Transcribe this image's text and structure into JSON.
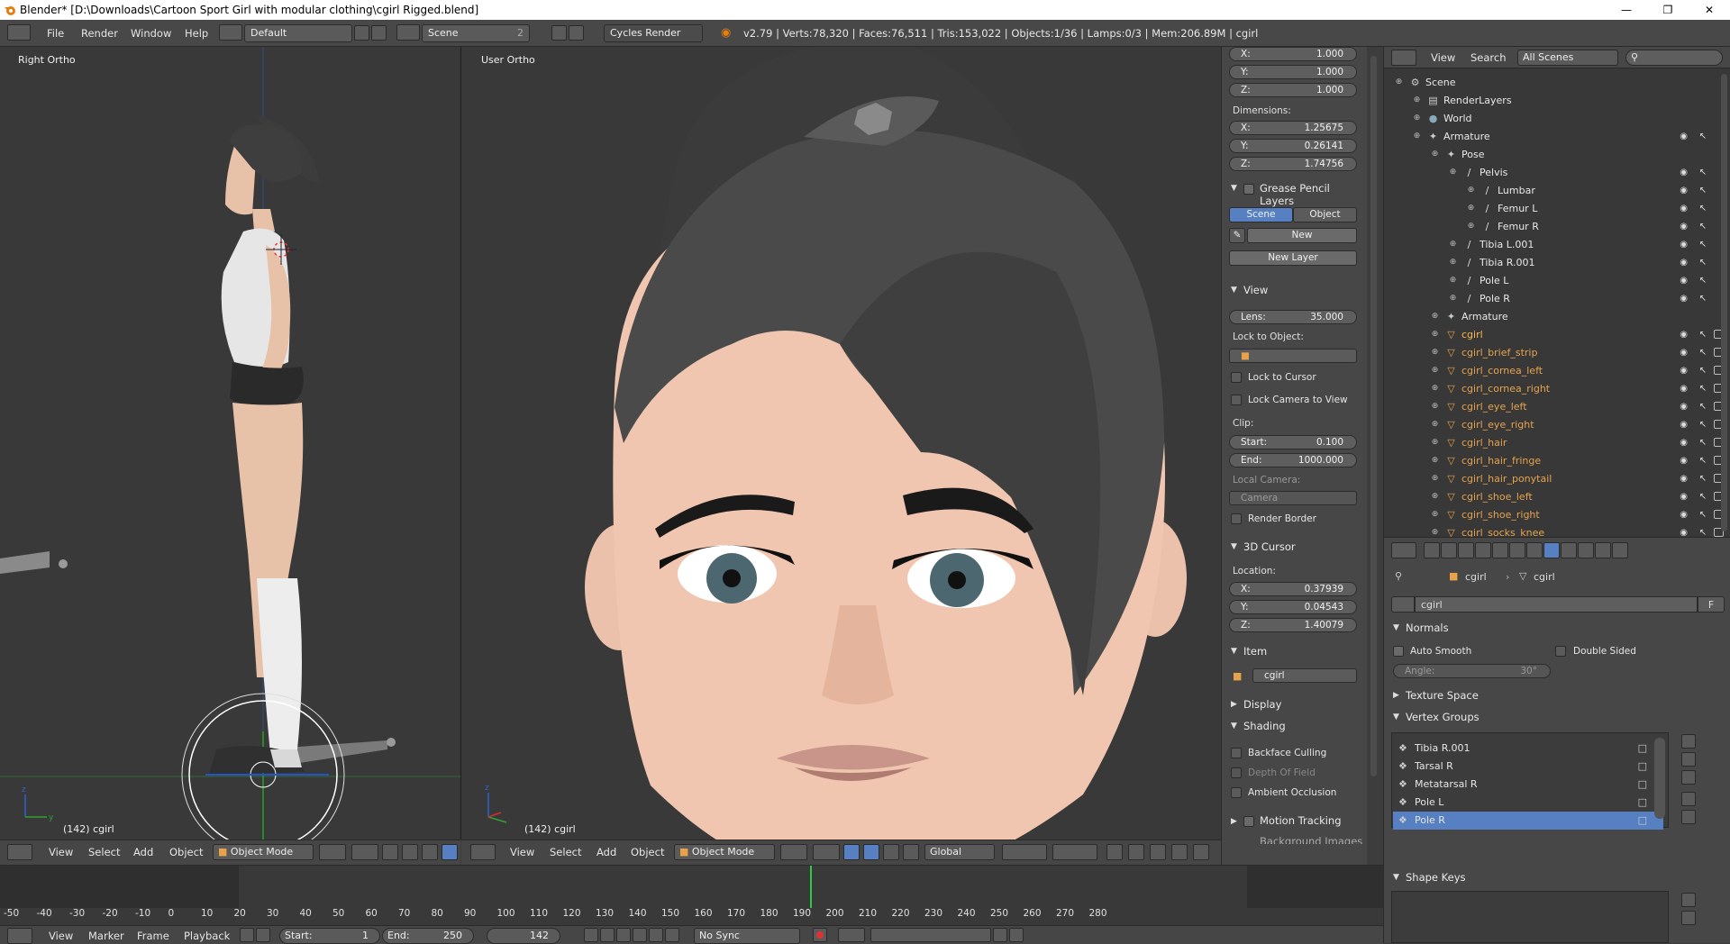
{
  "window": {
    "title": "Blender* [D:\\Downloads\\Cartoon Sport Girl with modular clothing\\cgirl Rigged.blend]"
  },
  "infobar": {
    "menus": [
      "File",
      "Render",
      "Window",
      "Help"
    ],
    "layout": "Default",
    "scene": "Scene",
    "scene_count": "2",
    "render_engine": "Cycles Render",
    "stats": "v2.79 | Verts:78,320 | Faces:76,511 | Tris:153,022 | Objects:1/36 | Lamps:0/3 | Mem:206.89M | cgirl"
  },
  "viewport_left": {
    "label": "Right Ortho",
    "frame_info": "(142) cgirl",
    "menus": [
      "View",
      "Select",
      "Add",
      "Object"
    ],
    "mode": "Object Mode"
  },
  "viewport_right": {
    "label": "User Ortho",
    "frame_info": "(142) cgirl",
    "menus": [
      "View",
      "Select",
      "Add",
      "Object"
    ],
    "mode": "Object Mode",
    "orientation": "Global"
  },
  "npanel": {
    "scale": [
      {
        "k": "X:",
        "v": "1.000"
      },
      {
        "k": "Y:",
        "v": "1.000"
      },
      {
        "k": "Z:",
        "v": "1.000"
      }
    ],
    "dimensions_label": "Dimensions:",
    "dimensions": [
      {
        "k": "X:",
        "v": "1.25675"
      },
      {
        "k": "Y:",
        "v": "0.26141"
      },
      {
        "k": "Z:",
        "v": "1.74756"
      }
    ],
    "grease_pencil": "Grease Pencil Layers",
    "gp_scene": "Scene",
    "gp_object": "Object",
    "gp_new": "New",
    "gp_new_layer": "New Layer",
    "view_title": "View",
    "lens_k": "Lens:",
    "lens_v": "35.000",
    "lock_to_object": "Lock to Object:",
    "lock_to_cursor": "Lock to Cursor",
    "lock_camera": "Lock Camera to View",
    "clip": "Clip:",
    "clip_start_k": "Start:",
    "clip_start_v": "0.100",
    "clip_end_k": "End:",
    "clip_end_v": "1000.000",
    "local_camera": "Local Camera:",
    "camera": "Camera",
    "render_border": "Render Border",
    "cursor_title": "3D Cursor",
    "location": "Location:",
    "cursor": [
      {
        "k": "X:",
        "v": "0.37939"
      },
      {
        "k": "Y:",
        "v": "0.04543"
      },
      {
        "k": "Z:",
        "v": "1.40079"
      }
    ],
    "item_title": "Item",
    "item_name": "cgirl",
    "display_title": "Display",
    "shading_title": "Shading",
    "backface": "Backface Culling",
    "depth_of_field": "Depth Of Field",
    "ambient_occlusion": "Ambient Occlusion",
    "motion_tracking": "Motion Tracking",
    "background_images": "Background Images"
  },
  "outliner": {
    "menus": [
      "View",
      "Search"
    ],
    "filter": "All Scenes",
    "rows": [
      {
        "name": "Scene"
      },
      {
        "name": "RenderLayers"
      },
      {
        "name": "World"
      },
      {
        "name": "Armature"
      },
      {
        "name": "Pose"
      },
      {
        "name": "Pelvis"
      },
      {
        "name": "Lumbar"
      },
      {
        "name": "Femur L"
      },
      {
        "name": "Femur R"
      },
      {
        "name": "Tibia L.001"
      },
      {
        "name": "Tibia R.001"
      },
      {
        "name": "Pole L"
      },
      {
        "name": "Pole R"
      },
      {
        "name": "Armature"
      },
      {
        "name": "cgirl"
      },
      {
        "name": "cgirl_brief_strip"
      },
      {
        "name": "cgirl_cornea_left"
      },
      {
        "name": "cgirl_cornea_right"
      },
      {
        "name": "cgirl_eye_left"
      },
      {
        "name": "cgirl_eye_right"
      },
      {
        "name": "cgirl_hair"
      },
      {
        "name": "cgirl_hair_fringe"
      },
      {
        "name": "cgirl_hair_ponytail"
      },
      {
        "name": "cgirl_shoe_left"
      },
      {
        "name": "cgirl_shoe_right"
      },
      {
        "name": "cgirl_socks_knee"
      }
    ]
  },
  "properties": {
    "breadcrumb_obj": "cgirl",
    "breadcrumb_mesh": "cgirl",
    "mesh_name": "cgirl",
    "fake_user": "F",
    "normals": "Normals",
    "auto_smooth": "Auto Smooth",
    "double_sided": "Double Sided",
    "angle_k": "Angle:",
    "angle_v": "30°",
    "texture_space": "Texture Space",
    "vertex_groups": "Vertex Groups",
    "groups": [
      "Tibia R.001",
      "Tarsal R",
      "Metatarsal R",
      "Pole L",
      "Pole R"
    ],
    "shape_keys": "Shape Keys"
  },
  "timeline": {
    "ticks": [
      "-50",
      "-40",
      "-30",
      "-20",
      "-10",
      "0",
      "10",
      "20",
      "30",
      "40",
      "50",
      "60",
      "70",
      "80",
      "90",
      "100",
      "110",
      "120",
      "130",
      "140",
      "150",
      "160",
      "170",
      "180",
      "190",
      "200",
      "210",
      "220",
      "230",
      "240",
      "250",
      "260",
      "270",
      "280"
    ],
    "menus": [
      "View",
      "Marker",
      "Frame",
      "Playback"
    ],
    "start_k": "Start:",
    "start_v": "1",
    "end_k": "End:",
    "end_v": "250",
    "current": "142",
    "sync": "No Sync"
  }
}
